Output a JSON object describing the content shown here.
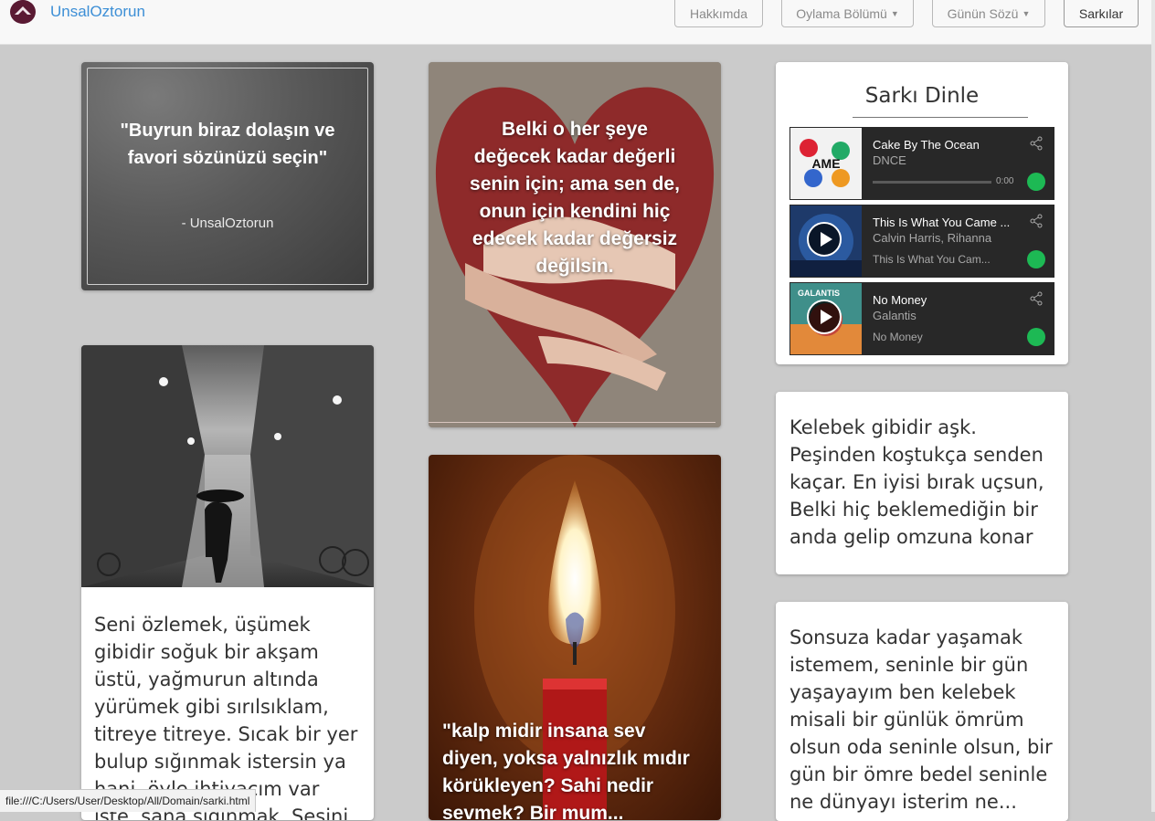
{
  "navbar": {
    "brand": "UnsalOztorun",
    "buttons": [
      "Hakkımda",
      "Oylama Bölümü",
      "Günün Sözü",
      "Sarkılar"
    ]
  },
  "quote_card": {
    "quote": "\"Buyrun biraz dolaşın ve favori sözünüzü seçin\"",
    "author": "- UnsalOztorun"
  },
  "heart_card": {
    "text": "Belki o her şeye değecek kadar değerli senin için; ama sen de, onun için kendini hiç edecek kadar değersiz değilsin."
  },
  "rain_card": {
    "text": "Seni özlemek, üşümek gibidir soğuk bir akşam üstü, yağmurun altında yürümek gibi sırılsıklam, titreye titreye. Sıcak bir yer bulup sığınmak istersin ya hani, öyle ihtiyacım var işte, sana sığınmak. Sesini duymak..."
  },
  "candle_card": {
    "text": "\"kalp midir insana sev diyen, yoksa yalnızlık mıdır körükleyen? Sahi nedir sevmek? Bir mum..."
  },
  "music": {
    "title": "Sarkı Dinle",
    "tracks": [
      {
        "title": "Cake By The Ocean",
        "artist": "DNCE",
        "time": "0:00",
        "sub": ""
      },
      {
        "title": "This Is What You Came ...",
        "artist": "Calvin Harris, Rihanna",
        "sub": "This Is What You Cam..."
      },
      {
        "title": "No Money",
        "artist": "Galantis",
        "sub": "No Money"
      }
    ]
  },
  "text_card_1": {
    "text": "Kelebek gibidir aşk. Peşinden koştukça senden kaçar. En iyisi bırak uçsun, Belki hiç beklemediğin bir anda gelip omzuna konar"
  },
  "text_card_2": {
    "text": "Sonsuza kadar yaşamak istemem, seninle bir gün yaşayayım ben kelebek misali bir günlük ömrüm olsun oda seninle olsun, bir gün bir ömre bedel seninle ne dünyayı isterim ne..."
  },
  "statusbar": {
    "url": "file:///C:/Users/User/Desktop/All/Domain/sarki.html"
  }
}
